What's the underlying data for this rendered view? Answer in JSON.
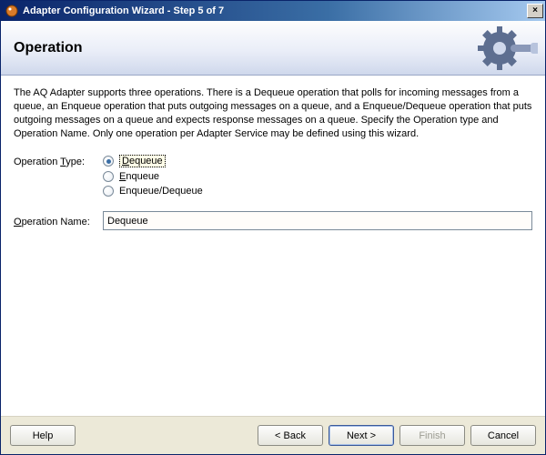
{
  "window": {
    "title": "Adapter Configuration Wizard - Step 5 of 7"
  },
  "header": {
    "heading": "Operation"
  },
  "description": "The AQ Adapter supports three operations.  There is a Dequeue operation that polls for incoming messages from a queue, an Enqueue operation that puts outgoing messages on a queue, and a Enqueue/Dequeue operation that puts outgoing messages on a queue and expects response messages on a queue.  Specify the Operation type and Operation Name. Only one operation per Adapter Service may be defined using this wizard.",
  "form": {
    "operation_type_label_prefix": "Operation ",
    "operation_type_label_u": "T",
    "operation_type_label_suffix": "ype:",
    "operation_name_label_u": "O",
    "operation_name_label_suffix": "peration Name:",
    "operation_name_value": "Dequeue",
    "radios": {
      "dequeue_u": "D",
      "dequeue_rest": "equeue",
      "enqueue_u": "E",
      "enqueue_rest": "nqueue",
      "both": "Enqueue/Dequeue"
    }
  },
  "footer": {
    "help": "Help",
    "back": "< Back",
    "next": "Next >",
    "finish": "Finish",
    "cancel": "Cancel"
  }
}
